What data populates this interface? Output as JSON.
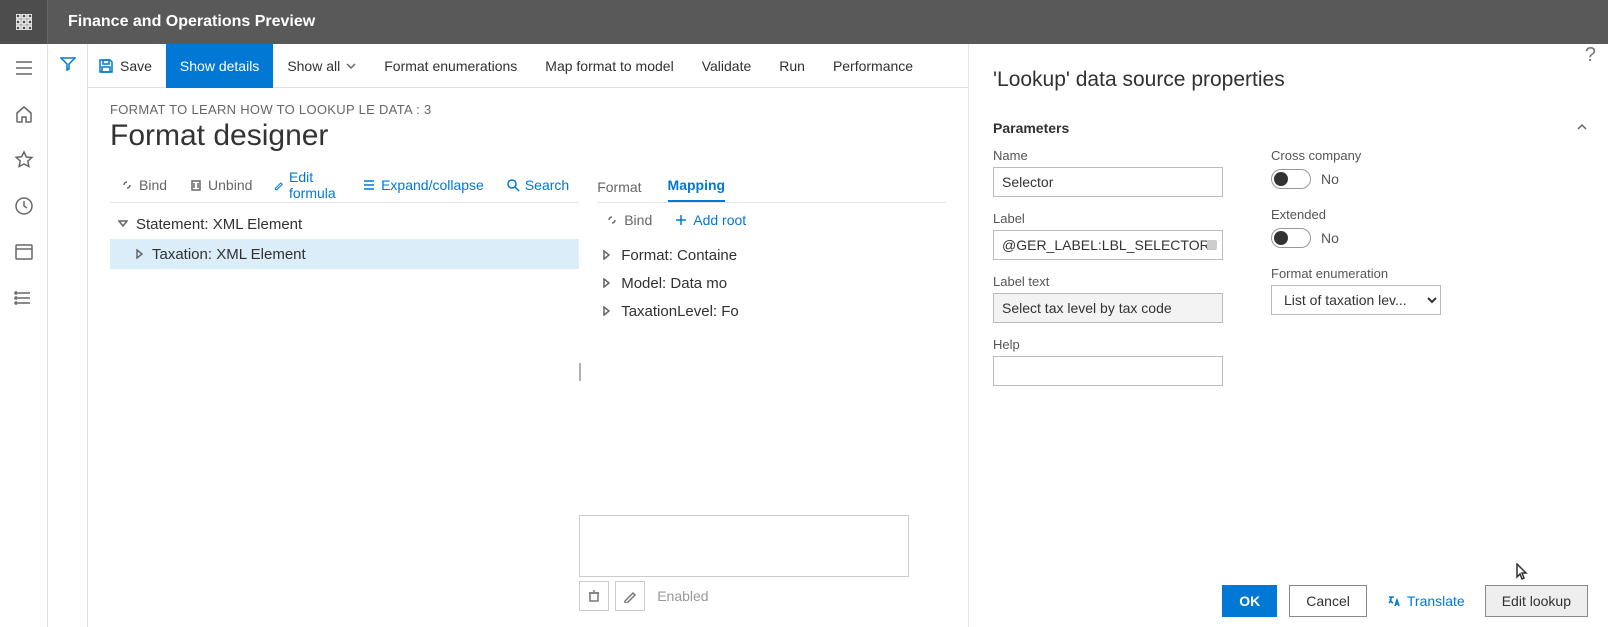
{
  "app": {
    "title": "Finance and Operations Preview"
  },
  "toolbar": {
    "save": "Save",
    "show_details": "Show details",
    "show_all": "Show all",
    "format_enum": "Format enumerations",
    "map_format": "Map format to model",
    "validate": "Validate",
    "run": "Run",
    "performance": "Performance "
  },
  "designer": {
    "breadcrumb": "FORMAT TO LEARN HOW TO LOOKUP LE DATA : 3",
    "title": "Format designer",
    "pane_tools": {
      "bind": "Bind",
      "unbind": "Unbind",
      "edit_formula": "Edit formula",
      "expand": "Expand/collapse",
      "search": "Search"
    },
    "tree": {
      "root": "Statement: XML Element",
      "child": "Taxation: XML Element"
    },
    "tabs": {
      "format": "Format",
      "mapping": "Mapping"
    },
    "mapping_tools": {
      "bind": "Bind",
      "add_root": "Add root"
    },
    "mapping_list": [
      "Format: Containe",
      "Model: Data mo",
      "TaxationLevel: Fo"
    ],
    "enabled": "Enabled"
  },
  "props": {
    "help": "?",
    "title": "'Lookup' data source properties",
    "section": "Parameters",
    "labels": {
      "name": "Name",
      "label": "Label",
      "label_text": "Label text",
      "help": "Help",
      "cross_company": "Cross company",
      "extended": "Extended",
      "format_enum": "Format enumeration"
    },
    "values": {
      "name": "Selector",
      "label": "@GER_LABEL:LBL_SELECTOR",
      "label_text": "Select tax level by tax code",
      "help": "",
      "cross_company": "No",
      "extended": "No",
      "format_enum": "List of taxation lev..."
    },
    "buttons": {
      "ok": "OK",
      "cancel": "Cancel",
      "translate": "Translate",
      "edit_lookup": "Edit lookup"
    }
  }
}
